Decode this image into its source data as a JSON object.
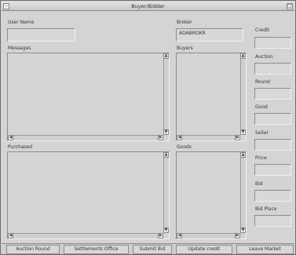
{
  "window": {
    "title": "Buyer/Bidder"
  },
  "left": {
    "user_name_label": "User Name",
    "user_name_value": "",
    "messages_label": "Messages",
    "purchased_label": "Purchased"
  },
  "middle": {
    "broker_label": "Broker",
    "broker_value": "ADABROKR",
    "buyers_label": "Buyers",
    "goods_label": "Goods"
  },
  "right": {
    "credit_label": "Credit",
    "auction_label": "Auction",
    "round_label": "Round",
    "good_label": "Good",
    "seller_label": "Seller",
    "price_label": "Price",
    "bid_label": "Bid",
    "bid_place_label": "Bid Place"
  },
  "buttons": [
    "Auction Round",
    "Settlements Office",
    "Submit Bid",
    "Update credit",
    "Leave Market"
  ]
}
